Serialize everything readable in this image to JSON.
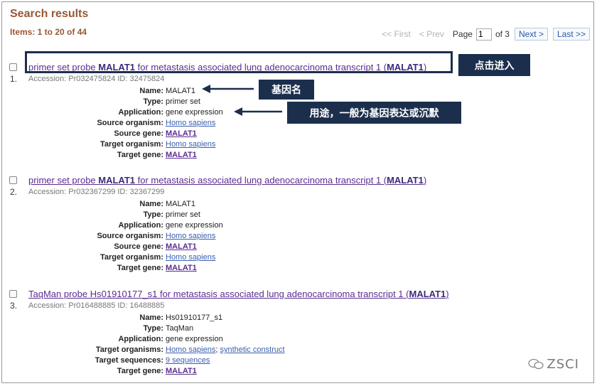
{
  "header": {
    "title": "Search results",
    "items_summary": "Items: 1 to 20 of 44"
  },
  "pager": {
    "first": "<< First",
    "prev": "< Prev",
    "page_label": "Page",
    "page_value": "1",
    "of_label": "of 3",
    "next": "Next >",
    "last": "Last >>"
  },
  "results": [
    {
      "num": "1.",
      "title_pre": "primer set probe ",
      "title_b1": "MALAT1",
      "title_mid": " for metastasis associated lung adenocarcinoma transcript 1 (",
      "title_b2": "MALAT1",
      "title_post": ")",
      "accession": "Accession: Pr032475824   ID: 32475824",
      "fields": {
        "name_label": "Name:",
        "name": "MALAT1",
        "type_label": "Type:",
        "type": "primer set",
        "app_label": "Application:",
        "app": "gene expression",
        "org_label": "Source organism:",
        "org": "Homo sapiens",
        "gene_label": "Source gene:",
        "gene": "MALAT1",
        "torg_label": "Target organism:",
        "torg": "Homo sapiens",
        "tgene_label": "Target gene:",
        "tgene": "MALAT1"
      }
    },
    {
      "num": "2.",
      "title_pre": "primer set probe ",
      "title_b1": "MALAT1",
      "title_mid": " for metastasis associated lung adenocarcinoma transcript 1 (",
      "title_b2": "MALAT1",
      "title_post": ")",
      "accession": "Accession: Pr032367299   ID: 32367299",
      "fields": {
        "name_label": "Name:",
        "name": "MALAT1",
        "type_label": "Type:",
        "type": "primer set",
        "app_label": "Application:",
        "app": "gene expression",
        "org_label": "Source organism:",
        "org": "Homo sapiens",
        "gene_label": "Source gene:",
        "gene": "MALAT1",
        "torg_label": "Target organism:",
        "torg": "Homo sapiens",
        "tgene_label": "Target gene:",
        "tgene": "MALAT1"
      }
    },
    {
      "num": "3.",
      "title_pre": "TaqMan probe Hs01910177_s1 for metastasis associated lung adenocarcinoma transcript 1 (",
      "title_b2": "MALAT1",
      "title_post": ")",
      "accession": "Accession: Pr016488885   ID: 16488885",
      "fields": {
        "name_label": "Name:",
        "name": "Hs01910177_s1",
        "type_label": "Type:",
        "type": "TaqMan",
        "app_label": "Application:",
        "app": "gene expression",
        "torgs_label": "Target organisms:",
        "torgs_a": "Homo sapiens",
        "torgs_sep": ";",
        "torgs_b": "synthetic construct",
        "tseq_label": "Target sequences:",
        "tseq": "9 sequences",
        "tgene_label": "Target gene:",
        "tgene": "MALAT1"
      }
    }
  ],
  "annotations": {
    "click_enter": "点击进入",
    "gene_name": "基因名",
    "usage": "用途，一般为基因表达或沉默",
    "color": "#1b2f4d"
  },
  "watermark": "ZSCI"
}
